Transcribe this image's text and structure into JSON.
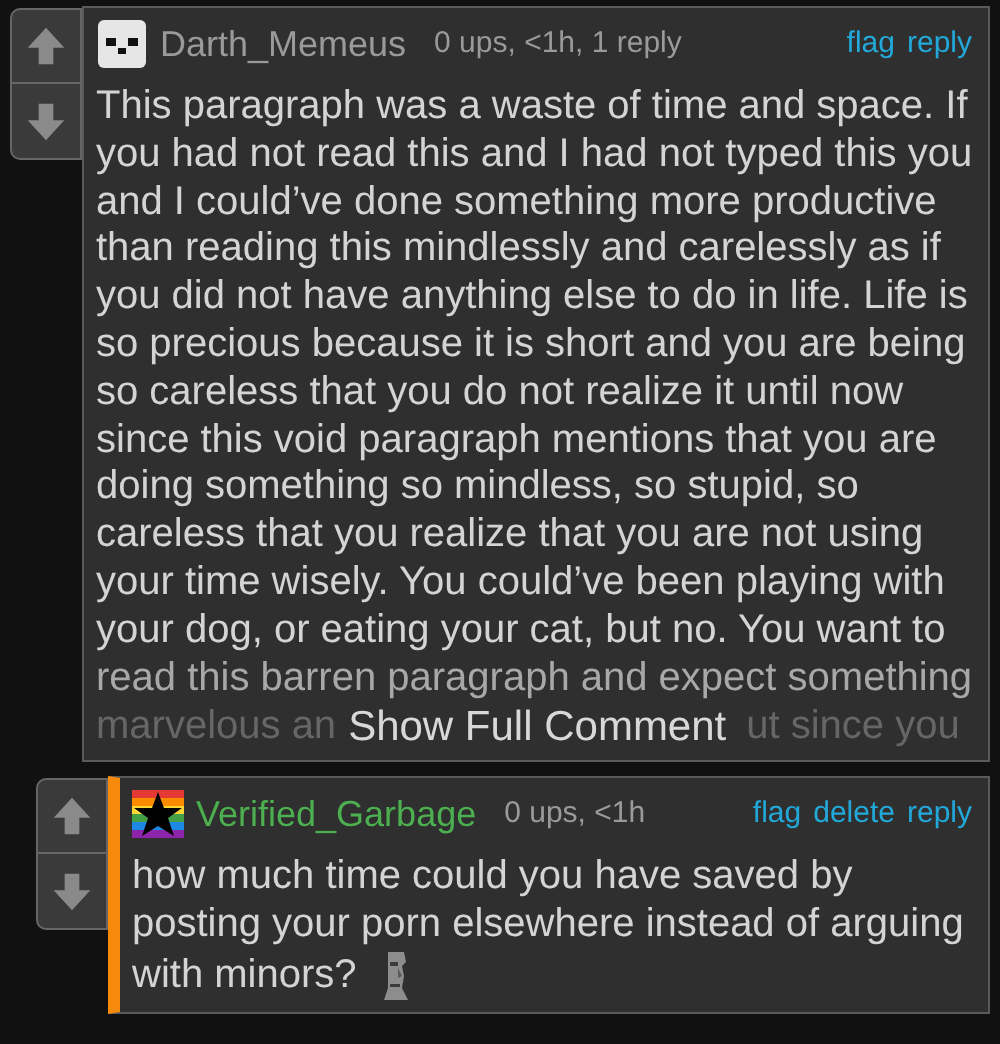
{
  "comments": [
    {
      "username": "Darth_Memeus",
      "avatar": {
        "kind": "skull"
      },
      "meta": "0 ups, <1h, 1 reply",
      "actions": [
        "flag",
        "reply"
      ],
      "highlighted": false,
      "lines": [
        "This paragraph was a waste of time and space. If",
        "you had not read this and I had not typed this you",
        "and I could’ve done something more productive",
        "than reading this mindlessly and carelessly as if",
        "you did not have anything else to do in life. Life is",
        "so precious because it is short and you are being",
        "so careless that you do not realize it until now",
        "since this void paragraph mentions that you are",
        "doing something so mindless, so stupid, so",
        "careless that you realize that you are not using",
        "your time wisely. You could’ve been playing with",
        "your dog, or eating your cat, but no. You want to",
        "read this barren paragraph and expect something"
      ],
      "hidden_head": "marvelous an",
      "hidden_tail": "ut since you",
      "expand_label": "Show Full Comment"
    },
    {
      "username": "Verified_Garbage",
      "avatar": {
        "kind": "flag"
      },
      "meta": "0 ups, <1h",
      "actions": [
        "flag",
        "delete",
        "reply"
      ],
      "highlighted": true,
      "lines": [
        "how much time could you have saved by",
        "posting your porn elsewhere instead of arguing",
        "with minors?"
      ],
      "emoji": {
        "kind": "moai"
      }
    }
  ]
}
